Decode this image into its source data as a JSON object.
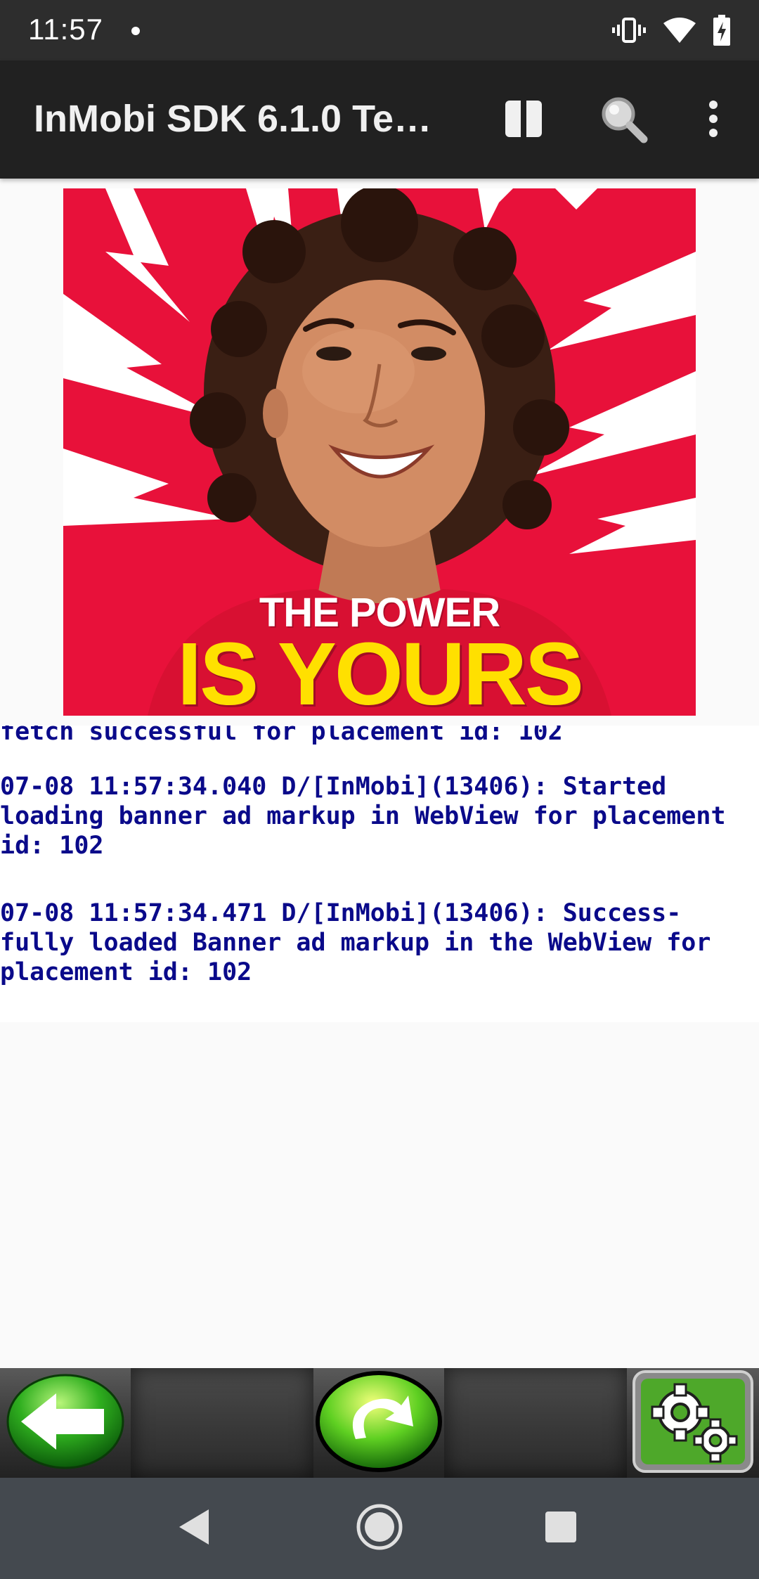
{
  "status_bar": {
    "time": "11:57",
    "icons": [
      "notification-dot-icon",
      "vibrate-icon",
      "wifi-icon",
      "battery-charging-icon"
    ]
  },
  "app_bar": {
    "title": "InMobi SDK 6.1.0 Te…",
    "actions": [
      "pause-icon",
      "search-icon",
      "overflow-menu-icon"
    ]
  },
  "ad": {
    "headline_line1": "THE POWER",
    "headline_line2": "IS YOURS",
    "background_color": "#e8113a",
    "headline_color": "#ffe000"
  },
  "log": {
    "partial_line": "fetch successful for placement id: 102",
    "entries": [
      "07-08 11:57:34.040 D/[InMobi](13406): Started\nloading banner ad markup in WebView for placement\nid: 102",
      "07-08 11:57:34.471 D/[InMobi](13406): Success-\nfully loaded Banner ad markup in the WebView for\nplacement id: 102"
    ],
    "text_color": "#0a0a8a"
  },
  "toolbar": {
    "buttons": [
      "back-arrow-icon",
      "refresh-icon",
      "settings-gears-icon"
    ]
  },
  "nav_bar": {
    "buttons": [
      "nav-back-icon",
      "nav-home-icon",
      "nav-recents-icon"
    ]
  }
}
